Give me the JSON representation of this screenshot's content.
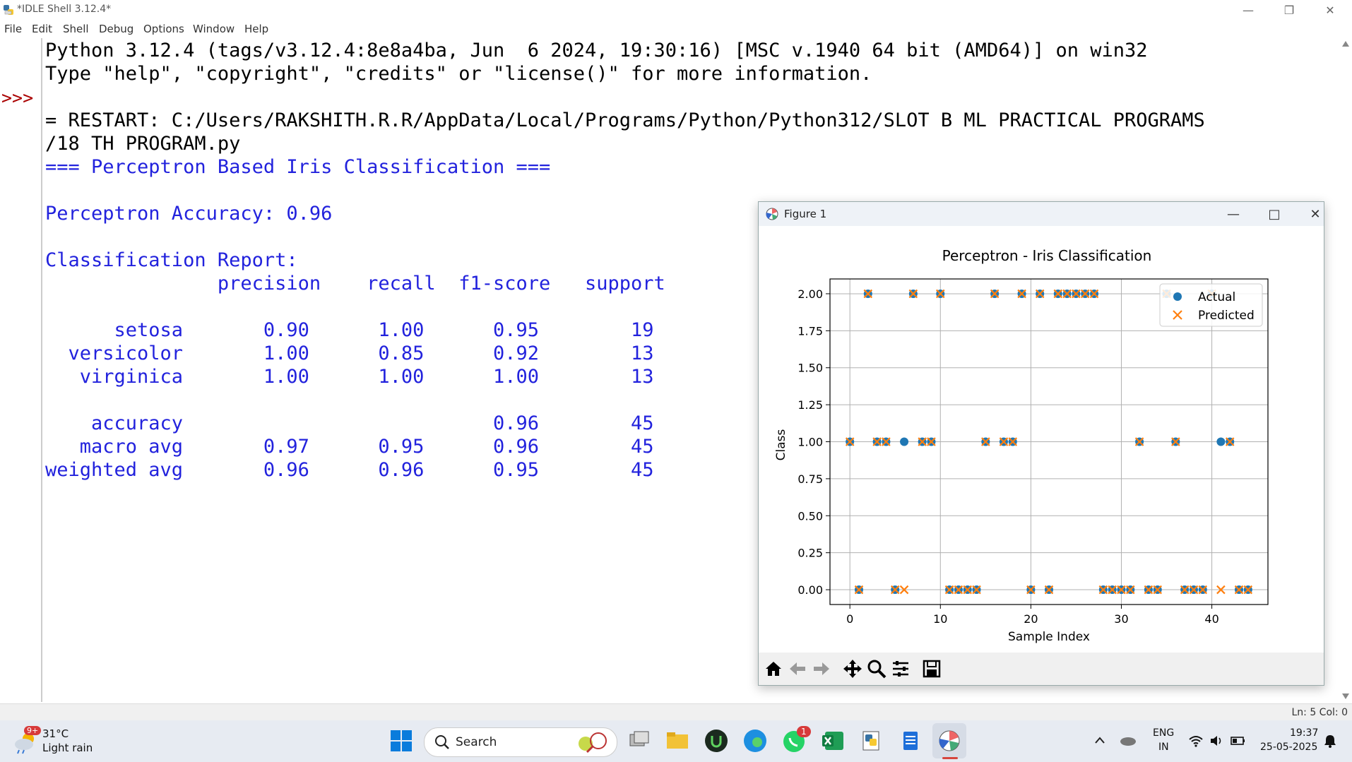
{
  "window": {
    "title": "*IDLE Shell 3.12.4*"
  },
  "menu": [
    "File",
    "Edit",
    "Shell",
    "Debug",
    "Options",
    "Window",
    "Help"
  ],
  "shell": {
    "prompt": ">>>",
    "lines": [
      {
        "text": "Python 3.12.4 (tags/v3.12.4:8e8a4ba, Jun  6 2024, 19:30:16) [MSC v.1940 64 bit (AMD64)] on win32",
        "color": "#000000"
      },
      {
        "text": "Type \"help\", \"copyright\", \"credits\" or \"license()\" for more information.",
        "color": "#000000"
      },
      {
        "text": "",
        "color": "#000000"
      },
      {
        "text": "= RESTART: C:/Users/RAKSHITH.R.R/AppData/Local/Programs/Python/Python312/SLOT B ML PRACTICAL PROGRAMS",
        "color": "#000000"
      },
      {
        "text": "/18 TH PROGRAM.py",
        "color": "#000000"
      },
      {
        "text": "=== Perceptron Based Iris Classification ===",
        "color": "#2222dd"
      },
      {
        "text": "",
        "color": "#2222dd"
      },
      {
        "text": "Perceptron Accuracy: 0.96",
        "color": "#2222dd"
      },
      {
        "text": "",
        "color": "#2222dd"
      },
      {
        "text": "Classification Report:",
        "color": "#2222dd"
      },
      {
        "text": "               precision    recall  f1-score   support",
        "color": "#2222dd"
      },
      {
        "text": "",
        "color": "#2222dd"
      },
      {
        "text": "      setosa       0.90      1.00      0.95        19",
        "color": "#2222dd"
      },
      {
        "text": "  versicolor       1.00      0.85      0.92        13",
        "color": "#2222dd"
      },
      {
        "text": "   virginica       1.00      1.00      1.00        13",
        "color": "#2222dd"
      },
      {
        "text": "",
        "color": "#2222dd"
      },
      {
        "text": "    accuracy                           0.96        45",
        "color": "#2222dd"
      },
      {
        "text": "   macro avg       0.97      0.95      0.96        45",
        "color": "#2222dd"
      },
      {
        "text": "weighted avg       0.96      0.96      0.95        45",
        "color": "#2222dd"
      }
    ]
  },
  "statusbar": {
    "position": "Ln: 5   Col: 0"
  },
  "figure": {
    "title": "Figure 1",
    "toolbar": [
      "home-icon",
      "back-icon",
      "forward-icon",
      "pan-icon",
      "zoom-icon",
      "configure-icon",
      "save-icon"
    ]
  },
  "chart_data": {
    "type": "scatter",
    "title": "Perceptron - Iris Classification",
    "xlabel": "Sample Index",
    "ylabel": "Class",
    "xlim": [
      -2.2,
      46.2
    ],
    "ylim": [
      -0.1,
      2.1
    ],
    "xticks": [
      "0",
      "10",
      "20",
      "30",
      "40"
    ],
    "yticks": [
      "0.00",
      "0.25",
      "0.50",
      "0.75",
      "1.00",
      "1.25",
      "1.50",
      "1.75",
      "2.00"
    ],
    "grid": true,
    "legend_position": "top-right",
    "series": [
      {
        "name": "Actual",
        "marker": "circle",
        "color": "#1f77b4",
        "x": [
          0,
          1,
          2,
          3,
          4,
          5,
          6,
          7,
          8,
          9,
          10,
          11,
          12,
          13,
          14,
          15,
          16,
          17,
          18,
          19,
          20,
          21,
          22,
          23,
          24,
          25,
          26,
          27,
          28,
          29,
          30,
          31,
          32,
          33,
          34,
          35,
          36,
          37,
          38,
          39,
          40,
          41,
          42,
          43,
          44
        ],
        "y": [
          1,
          0,
          2,
          1,
          1,
          0,
          1,
          2,
          1,
          1,
          2,
          0,
          0,
          0,
          0,
          1,
          2,
          1,
          1,
          2,
          0,
          2,
          0,
          2,
          2,
          2,
          2,
          2,
          0,
          0,
          0,
          0,
          1,
          0,
          0,
          2,
          1,
          0,
          0,
          0,
          2,
          1,
          1,
          0,
          0
        ]
      },
      {
        "name": "Predicted",
        "marker": "x",
        "color": "#ff7f0e",
        "x": [
          0,
          1,
          2,
          3,
          4,
          5,
          6,
          7,
          8,
          9,
          10,
          11,
          12,
          13,
          14,
          15,
          16,
          17,
          18,
          19,
          20,
          21,
          22,
          23,
          24,
          25,
          26,
          27,
          28,
          29,
          30,
          31,
          32,
          33,
          34,
          35,
          36,
          37,
          38,
          39,
          40,
          41,
          42,
          43,
          44
        ],
        "y": [
          1,
          0,
          2,
          1,
          1,
          0,
          0,
          2,
          1,
          1,
          2,
          0,
          0,
          0,
          0,
          1,
          2,
          1,
          1,
          2,
          0,
          2,
          0,
          2,
          2,
          2,
          2,
          2,
          0,
          0,
          0,
          0,
          1,
          0,
          0,
          2,
          1,
          0,
          0,
          0,
          2,
          0,
          1,
          0,
          0
        ]
      }
    ]
  },
  "taskbar": {
    "weather_temp": "31°C",
    "weather_desc": "Light rain",
    "weather_badge": "9+",
    "search_label": "Search",
    "whatsapp_badge": "1",
    "lang_top": "ENG",
    "lang_bottom": "IN",
    "time": "19:37",
    "date": "25-05-2025"
  }
}
